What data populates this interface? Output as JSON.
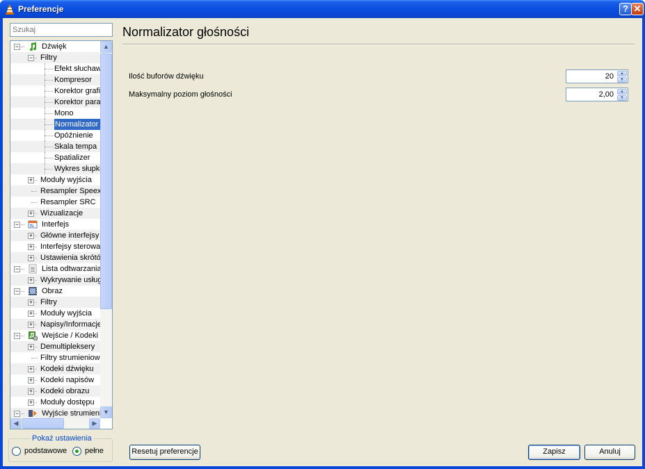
{
  "window": {
    "title": "Preferencje",
    "help_glyph": "?",
    "close_glyph": "✕"
  },
  "search": {
    "placeholder": "Szukaj"
  },
  "tree": [
    {
      "label": "Dźwięk",
      "level": 0,
      "expander": "−",
      "icon": "music-note-icon",
      "alt": false
    },
    {
      "label": "Filtry",
      "level": 1,
      "expander": "−",
      "icon": null,
      "alt": true
    },
    {
      "label": "Efekt słuchaw",
      "level": 2,
      "expander": null,
      "icon": null,
      "alt": false
    },
    {
      "label": "Kompresor",
      "level": 2,
      "expander": null,
      "icon": null,
      "alt": true
    },
    {
      "label": "Korektor grafi",
      "level": 2,
      "expander": null,
      "icon": null,
      "alt": false
    },
    {
      "label": "Korektor para",
      "level": 2,
      "expander": null,
      "icon": null,
      "alt": true
    },
    {
      "label": "Mono",
      "level": 2,
      "expander": null,
      "icon": null,
      "alt": false
    },
    {
      "label": "Normalizator g",
      "level": 2,
      "expander": null,
      "icon": null,
      "alt": true,
      "selected": true
    },
    {
      "label": "Opóźnienie",
      "level": 2,
      "expander": null,
      "icon": null,
      "alt": false
    },
    {
      "label": "Skala tempa",
      "level": 2,
      "expander": null,
      "icon": null,
      "alt": true
    },
    {
      "label": "Spatializer",
      "level": 2,
      "expander": null,
      "icon": null,
      "alt": false
    },
    {
      "label": "Wykres słupko",
      "level": 2,
      "expander": null,
      "icon": null,
      "alt": true
    },
    {
      "label": "Moduły wyjścia",
      "level": 1,
      "expander": "+",
      "icon": null,
      "alt": false
    },
    {
      "label": "Resampler Speex",
      "level": 1,
      "expander": null,
      "icon": null,
      "alt": true
    },
    {
      "label": "Resampler SRC",
      "level": 1,
      "expander": null,
      "icon": null,
      "alt": false
    },
    {
      "label": "Wizualizacje",
      "level": 1,
      "expander": "+",
      "icon": null,
      "alt": true
    },
    {
      "label": "Interfejs",
      "level": 0,
      "expander": "−",
      "icon": "interface-icon",
      "alt": false
    },
    {
      "label": "Główne interfejsy",
      "level": 1,
      "expander": "+",
      "icon": null,
      "alt": true
    },
    {
      "label": "Interfejsy sterowa",
      "level": 1,
      "expander": "+",
      "icon": null,
      "alt": false
    },
    {
      "label": "Ustawienia skrótó",
      "level": 1,
      "expander": "+",
      "icon": null,
      "alt": true
    },
    {
      "label": "Lista odtwarzania",
      "level": 0,
      "expander": "−",
      "icon": "playlist-icon",
      "alt": false
    },
    {
      "label": "Wykrywanie usług",
      "level": 1,
      "expander": "+",
      "icon": null,
      "alt": true
    },
    {
      "label": "Obraz",
      "level": 0,
      "expander": "−",
      "icon": "video-film-icon",
      "alt": false
    },
    {
      "label": "Filtry",
      "level": 1,
      "expander": "+",
      "icon": null,
      "alt": true
    },
    {
      "label": "Moduły wyjścia",
      "level": 1,
      "expander": "+",
      "icon": null,
      "alt": false
    },
    {
      "label": "Napisy/Informacje",
      "level": 1,
      "expander": "+",
      "icon": null,
      "alt": true
    },
    {
      "label": "Wejście / Kodeki",
      "level": 0,
      "expander": "−",
      "icon": "input-codecs-icon",
      "alt": false
    },
    {
      "label": "Demultipleksery",
      "level": 1,
      "expander": "+",
      "icon": null,
      "alt": true
    },
    {
      "label": "Filtry strumieniowa",
      "level": 1,
      "expander": null,
      "icon": null,
      "alt": false
    },
    {
      "label": "Kodeki dźwięku",
      "level": 1,
      "expander": "+",
      "icon": null,
      "alt": true
    },
    {
      "label": "Kodeki napisów",
      "level": 1,
      "expander": "+",
      "icon": null,
      "alt": false
    },
    {
      "label": "Kodeki obrazu",
      "level": 1,
      "expander": "+",
      "icon": null,
      "alt": true
    },
    {
      "label": "Moduły dostępu",
      "level": 1,
      "expander": "+",
      "icon": null,
      "alt": false
    },
    {
      "label": "Wyjście strumieni",
      "level": 0,
      "expander": "−",
      "icon": "stream-output-icon",
      "alt": true
    }
  ],
  "show_settings": {
    "legend": "Pokaż ustawienia",
    "options": [
      {
        "label": "podstawowe",
        "checked": false
      },
      {
        "label": "pełne",
        "checked": true
      }
    ]
  },
  "panel": {
    "title": "Normalizator głośności",
    "options": [
      {
        "label": "Ilość buforów dźwięku",
        "value": "20"
      },
      {
        "label": "Maksymalny poziom głośności",
        "value": "2,00"
      }
    ]
  },
  "buttons": {
    "reset": "Resetuj preferencje",
    "save": "Zapisz",
    "cancel": "Anuluj"
  },
  "colors": {
    "selection": "#316ac5",
    "titlebar": "#0a4fdf",
    "accent": "#0046d5"
  }
}
